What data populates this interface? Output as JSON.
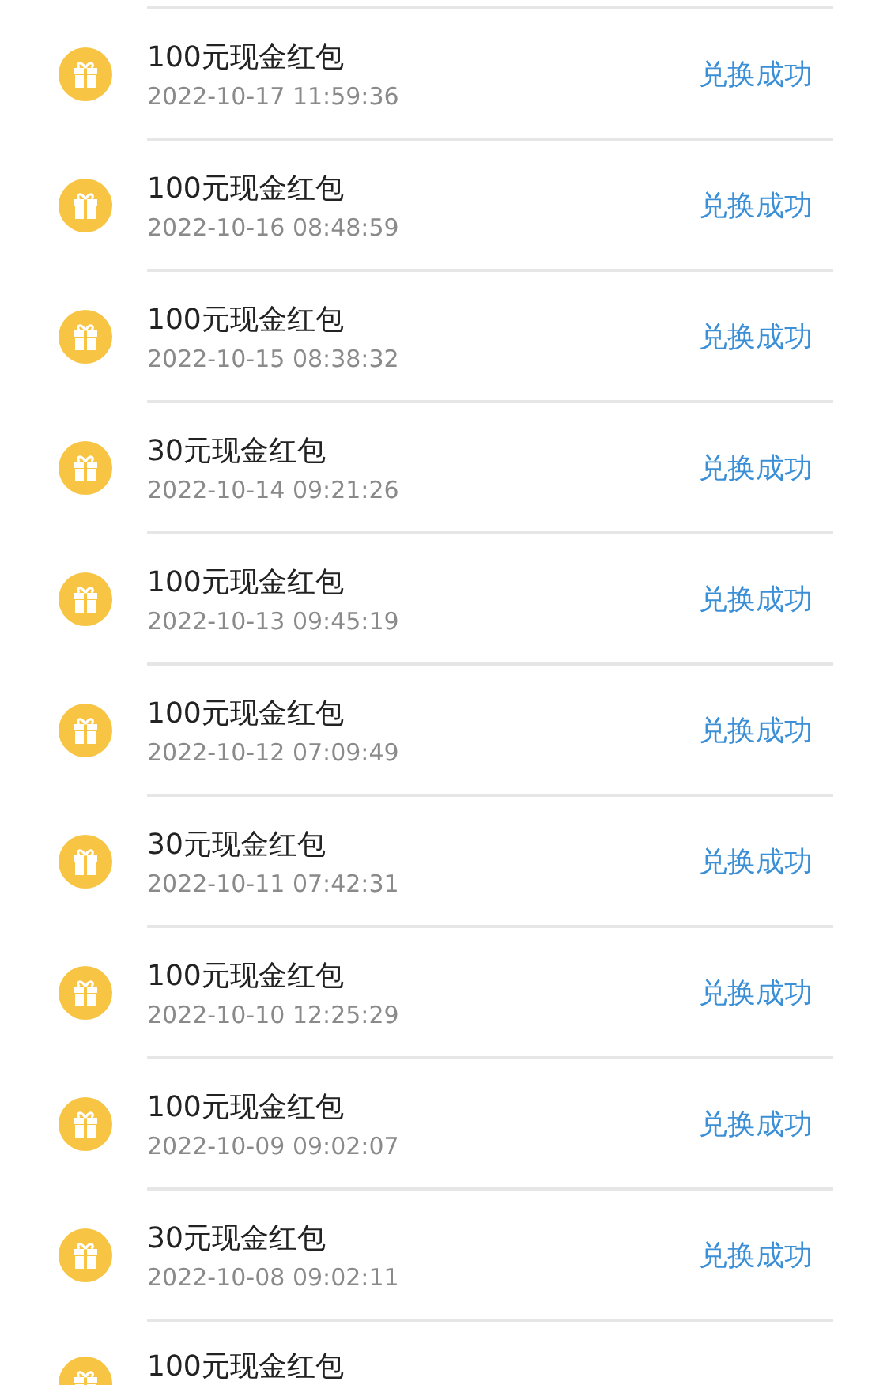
{
  "records": [
    {
      "title": "100元现金红包",
      "time": "2022-10-17 11:59:36",
      "status": "兑换成功"
    },
    {
      "title": "100元现金红包",
      "time": "2022-10-16 08:48:59",
      "status": "兑换成功"
    },
    {
      "title": "100元现金红包",
      "time": "2022-10-15 08:38:32",
      "status": "兑换成功"
    },
    {
      "title": "30元现金红包",
      "time": "2022-10-14 09:21:26",
      "status": "兑换成功"
    },
    {
      "title": "100元现金红包",
      "time": "2022-10-13 09:45:19",
      "status": "兑换成功"
    },
    {
      "title": "100元现金红包",
      "time": "2022-10-12 07:09:49",
      "status": "兑换成功"
    },
    {
      "title": "30元现金红包",
      "time": "2022-10-11 07:42:31",
      "status": "兑换成功"
    },
    {
      "title": "100元现金红包",
      "time": "2022-10-10 12:25:29",
      "status": "兑换成功"
    },
    {
      "title": "100元现金红包",
      "time": "2022-10-09 09:02:07",
      "status": "兑换成功"
    },
    {
      "title": "30元现金红包",
      "time": "2022-10-08 09:02:11",
      "status": "兑换成功"
    },
    {
      "title": "100元现金红包"
    }
  ]
}
